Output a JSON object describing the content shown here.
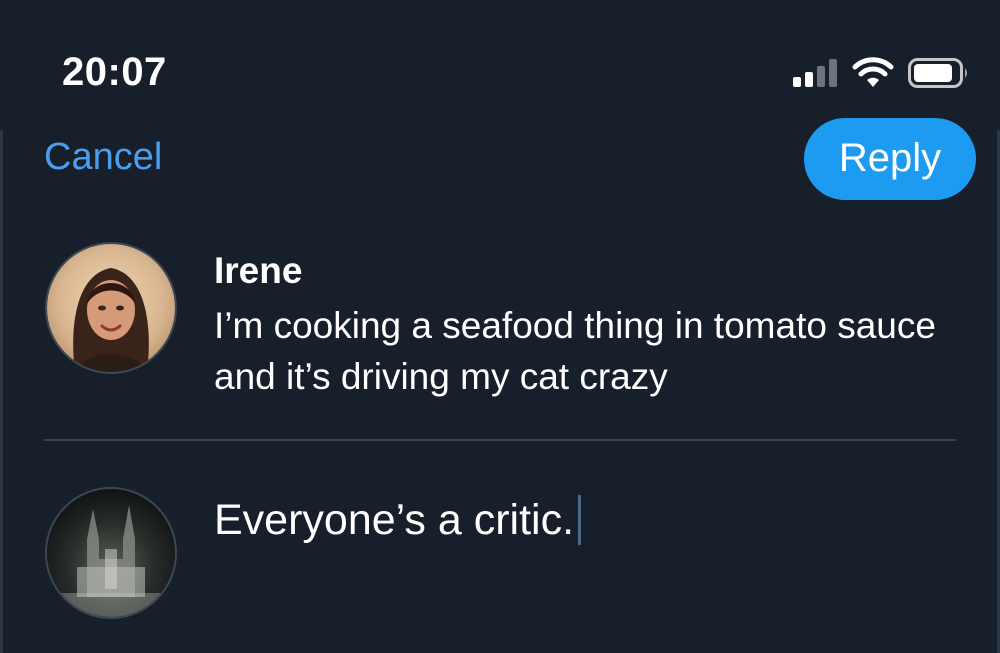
{
  "status_bar": {
    "time": "20:07",
    "icons": [
      "signal-icon",
      "wifi-icon",
      "battery-icon"
    ]
  },
  "header": {
    "cancel_label": "Cancel",
    "reply_label": "Reply"
  },
  "original_tweet": {
    "author": "Irene",
    "text": "I’m cooking a seafood thing in tomato sauce and it’s driving my cat crazy",
    "avatar": "user-avatar-photo"
  },
  "composer": {
    "value": "Everyone’s a critic.",
    "avatar": "own-avatar-cathedral-photo"
  },
  "colors": {
    "background": "#161f2a",
    "accent": "#1d9bf0",
    "link": "#4a9eed",
    "divider": "#38444d",
    "text": "#ffffff"
  }
}
